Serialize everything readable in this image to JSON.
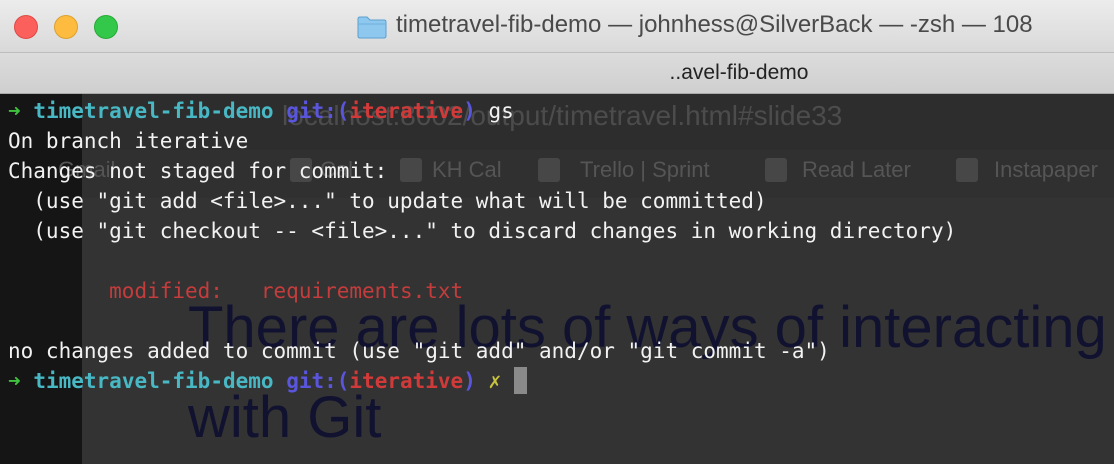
{
  "window": {
    "title": "timetravel-fib-demo — johnhess@SilverBack — -zsh — 108",
    "tab_label": "..avel-fib-demo",
    "icons": [
      "folder-icon",
      "close-button",
      "minimize-button",
      "zoom-button"
    ]
  },
  "terminal": {
    "prompt": {
      "arrow": "➜",
      "directory": "timetravel-fib-demo",
      "git_label": "git:(",
      "branch": "iterative",
      "git_close": ")",
      "dirty_marker": "✗"
    },
    "command": "gs",
    "output": [
      "On branch iterative",
      "Changes not staged for commit:",
      "  (use \"git add <file>...\" to update what will be committed)",
      "  (use \"git checkout -- <file>...\" to discard changes in working directory)"
    ],
    "modified_label": "modified:",
    "modified_file": "requirements.txt",
    "summary": "no changes added to commit (use \"git add\" and/or \"git commit -a\")"
  },
  "background_window": {
    "url": "localhost:8002/output/timetravel.html#slide33",
    "bookmarks": [
      "Gmail",
      "Cal",
      "KH Cal",
      "Trello | Sprint",
      "Read Later",
      "Instapaper"
    ],
    "slide_line1": "There are lots of ways of interacting",
    "slide_line2": "with Git"
  },
  "colors": {
    "prompt_arrow": "#3fc33f",
    "directory": "#48b8c4",
    "git_label": "#5a55dd",
    "branch": "#d23a3a",
    "modified": "#c43c3c",
    "dirty_marker": "#c9c43e"
  }
}
